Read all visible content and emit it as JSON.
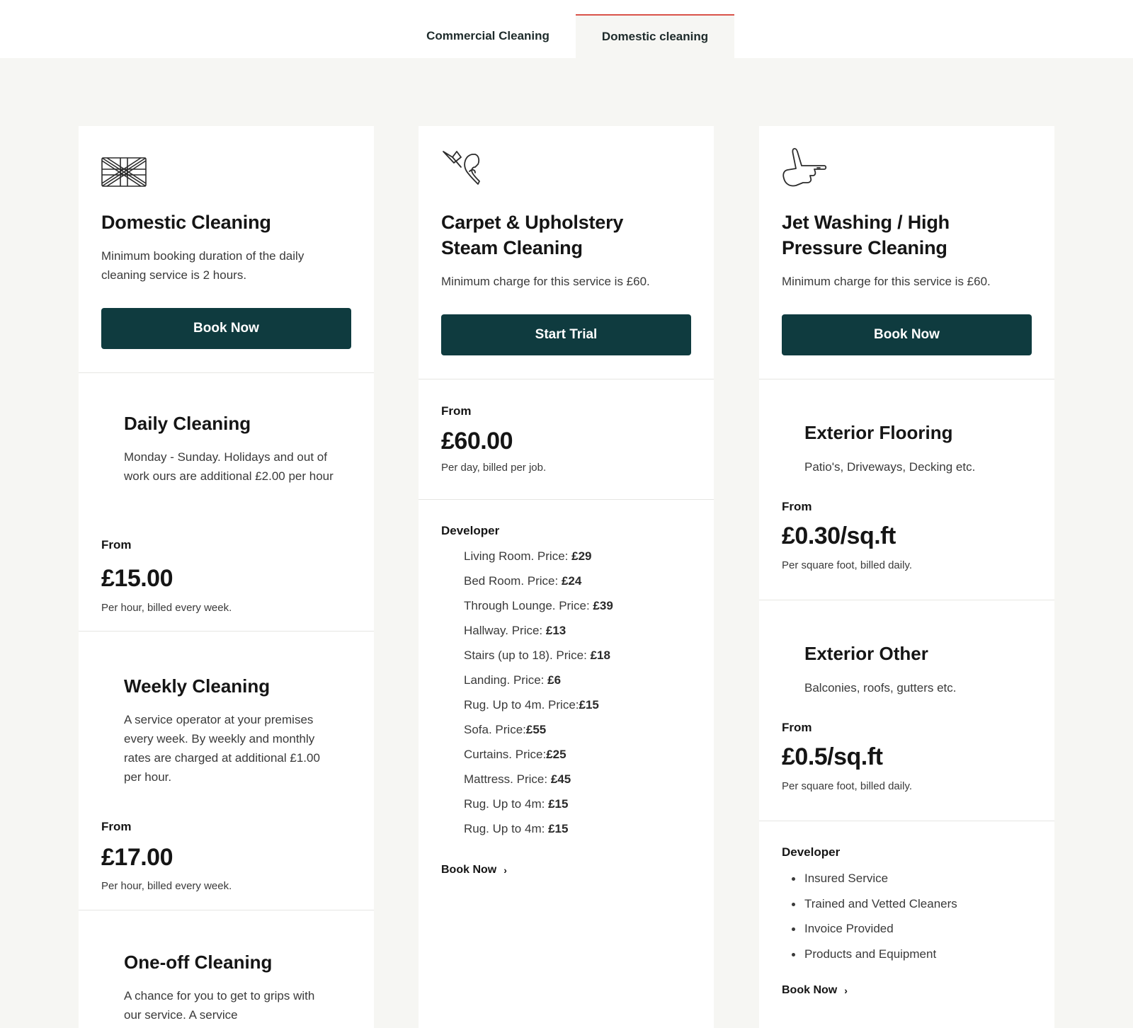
{
  "tabs": [
    {
      "label": "Commercial Cleaning",
      "active": false
    },
    {
      "label": "Domestic cleaning",
      "active": true
    }
  ],
  "colors": {
    "accent": "#d9534a",
    "button": "#0f3b3f",
    "background": "#f6f6f3"
  },
  "cards": [
    {
      "icon": "uk-flag-icon",
      "title": "Domestic Cleaning",
      "description": "Minimum booking duration of the daily cleaning service is 2 hours.",
      "button": "Book Now",
      "plans": [
        {
          "title": "Daily Cleaning",
          "description": "Monday - Sunday. Holidays and out of work ours are additional £2.00 per hour",
          "from": "From",
          "price": "£15.00",
          "billing": "Per hour, billed every week."
        },
        {
          "title": "Weekly Cleaning",
          "description": "A service operator at your premises every week. By weekly and monthly rates are charged at additional £1.00 per hour.",
          "from": "From",
          "price": "£17.00",
          "billing": "Per hour, billed every week."
        },
        {
          "title": "One-off Cleaning",
          "description": "A chance for you to get to grips with our service. A service"
        }
      ]
    },
    {
      "icon": "phone-return-icon",
      "title_line1": "Carpet & Upholstery",
      "title_line2": "Steam Cleaning",
      "description": "Minimum charge for this service is £60.",
      "button": "Start Trial",
      "from": "From",
      "price": "£60.00",
      "billing": "Per day, billed per job.",
      "developer": "Developer",
      "items": [
        {
          "name": "Living Room. Price: ",
          "price": "£29"
        },
        {
          "name": "Bed Room. Price: ",
          "price": "£24"
        },
        {
          "name": "Through Lounge. Price: ",
          "price": "£39"
        },
        {
          "name": "Hallway. Price: ",
          "price": "£13"
        },
        {
          "name": "Stairs (up to 18). Price: ",
          "price": "£18"
        },
        {
          "name": "Landing. Price: ",
          "price": "£6"
        },
        {
          "name": "Rug. Up to 4m. Price:",
          "price": "£15"
        },
        {
          "name": "Sofa. Price:",
          "price": "£55"
        },
        {
          "name": "Curtains. Price:",
          "price": "£25"
        },
        {
          "name": "Mattress. Price: ",
          "price": "£45"
        },
        {
          "name": "Rug. Up to 4m: ",
          "price": "£15"
        },
        {
          "name": "Rug. Up to 4m: ",
          "price": "£15"
        }
      ],
      "link": "Book Now"
    },
    {
      "icon": "pointing-hand-icon",
      "title_line1": "Jet Washing / High",
      "title_line2": "Pressure Cleaning",
      "description": "Minimum charge for this service is £60.",
      "button": "Book Now",
      "plans": [
        {
          "title": "Exterior Flooring",
          "description": "Patio's, Driveways, Decking etc.",
          "from": "From",
          "price": "£0.30/sq.ft",
          "billing": "Per square foot, billed daily."
        },
        {
          "title": "Exterior Other",
          "description": "Balconies, roofs, gutters etc.",
          "from": "From",
          "price": "£0.5/sq.ft",
          "billing": "Per square foot, billed daily."
        }
      ],
      "developer": "Developer",
      "features": [
        "Insured Service",
        "Trained and Vetted Cleaners",
        "Invoice Provided",
        "Products and Equipment"
      ],
      "link": "Book Now"
    }
  ]
}
